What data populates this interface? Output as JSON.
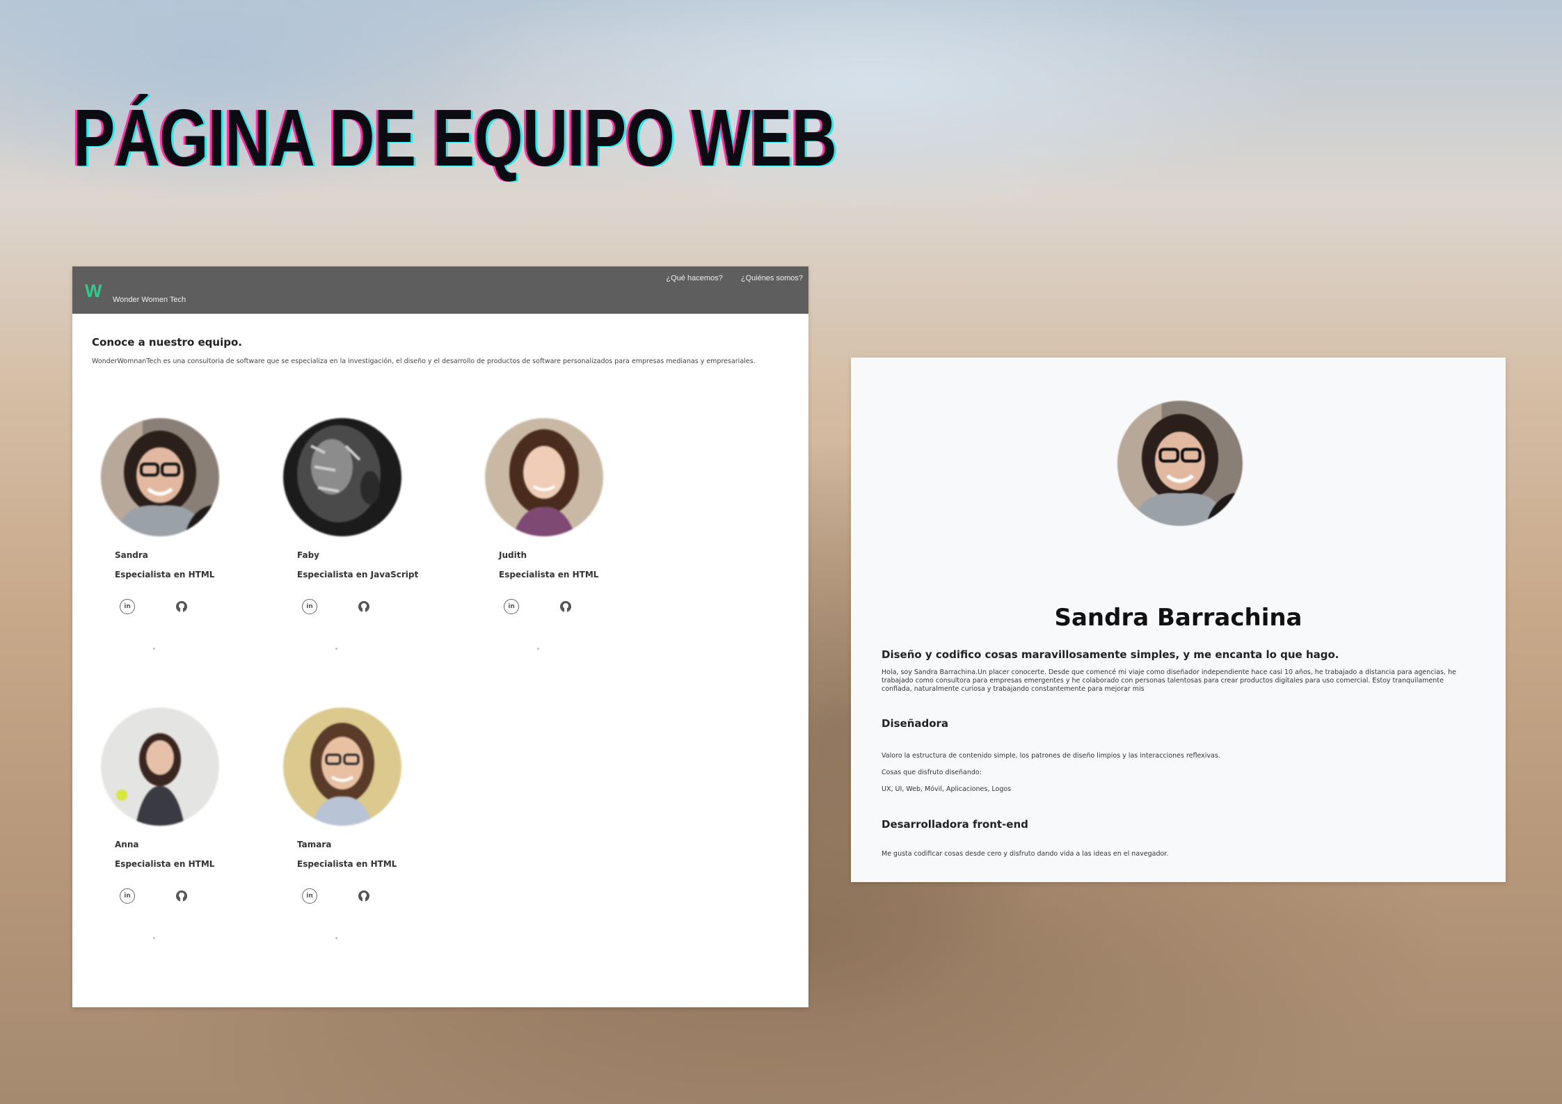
{
  "slide": {
    "title": "PÁGINA DE EQUIPO WEB"
  },
  "team_page": {
    "nav": {
      "logo": "W",
      "brand": "Wonder Women Tech",
      "links": [
        "¿Qué hacemos?",
        "¿Quiénes somos?"
      ]
    },
    "heading": "Conoce a nuestro equipo.",
    "intro": "WonderWomnanTech es una consultoria de software que se especializa en la investigación, el diseño y el desarrollo de productos de software personalizados para empresas medianas y empresariales.",
    "members": [
      {
        "name": "Sandra",
        "role": "Especialista en HTML",
        "linkedin_icon": "in"
      },
      {
        "name": "Faby",
        "role": "Especialista en JavaScript",
        "linkedin_icon": "in"
      },
      {
        "name": "Judith",
        "role": "Especialista en HTML",
        "linkedin_icon": "in"
      },
      {
        "name": "Anna",
        "role": "Especialista en HTML",
        "linkedin_icon": "in"
      },
      {
        "name": "Tamara",
        "role": "Especialista en HTML",
        "linkedin_icon": "in"
      }
    ]
  },
  "profile_page": {
    "name": "Sandra Barrachina",
    "tagline": "Diseño y codifico cosas maravillosamente simples, y me encanta lo que hago.",
    "bio": "Hola, soy Sandra Barrachina.Un placer conocerte. Desde que comencé mi viaje como diseñador independiente hace casi 10 años, he trabajado a distancia para agencias, he trabajado como consultora para empresas emergentes y he colaborado con personas talentosas para crear productos digitales para uso comercial. Estoy tranquilamente confiada, naturalmente curiosa y trabajando constantemente para mejorar mis",
    "designer": {
      "title": "Diseñadora",
      "line1": "Valoro la estructura de contenido simple, los patrones de diseño limpios y las interacciones reflexivas.",
      "line2": "Cosas que disfruto diseñando:",
      "line3": "UX, UI, Web, Móvil, Aplicaciones, Logos"
    },
    "frontend": {
      "title": "Desarrolladora front-end",
      "line1": "Me gusta codificar cosas desde cero y disfruto dando vida a las ideas en el navegador."
    }
  },
  "colors": {
    "nav_bg": "#5e5e5e",
    "logo": "#33c98a",
    "title_shadow_pink": "#ff2fa8",
    "title_shadow_cyan": "#2ee6e6"
  },
  "icons": [
    "linkedin-icon",
    "github-icon"
  ]
}
